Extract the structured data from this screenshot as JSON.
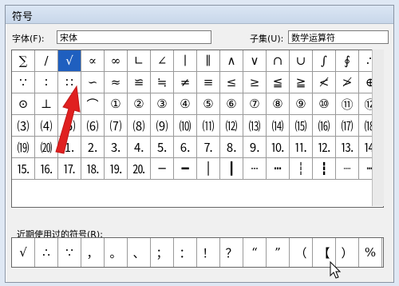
{
  "window": {
    "title": "符号"
  },
  "font": {
    "label": "字体(F):",
    "value": "宋体"
  },
  "subset": {
    "label": "子集(U):",
    "value": "数学运算符"
  },
  "grid": {
    "rows": [
      [
        "∑",
        "/",
        "√",
        "∝",
        "∞",
        "∟",
        "∠",
        "∣",
        "∥",
        "∧",
        "∨",
        "∩",
        "∪",
        "∫",
        "∮",
        "∴"
      ],
      [
        "∵",
        "∶",
        "∷",
        "∽",
        "≈",
        "≌",
        "≒",
        "≠",
        "≡",
        "≤",
        "≥",
        "≦",
        "≧",
        "≮",
        "≯",
        "⊕"
      ],
      [
        "⊙",
        "⊥",
        "⊿",
        "⌒",
        "①",
        "②",
        "③",
        "④",
        "⑤",
        "⑥",
        "⑦",
        "⑧",
        "⑨",
        "⑩",
        "⑪",
        "⑫"
      ],
      [
        "⑶",
        "⑷",
        "⑸",
        "⑹",
        "⑺",
        "⑻",
        "⑼",
        "⑽",
        "⑾",
        "⑿",
        "⒀",
        "⒁",
        "⒂",
        "⒃",
        "⒄",
        "⒅"
      ],
      [
        "⒆",
        "⒇",
        "⒈",
        "⒉",
        "⒊",
        "⒋",
        "⒌",
        "⒍",
        "⒎",
        "⒏",
        "⒐",
        "⒑",
        "⒒",
        "⒓",
        "⒔",
        "⒕"
      ],
      [
        "⒖",
        "⒗",
        "⒘",
        "⒙",
        "⒚",
        "⒛",
        "─",
        "━",
        "│",
        "┃",
        "┄",
        "┅",
        "┆",
        "┇",
        "┈",
        "┉"
      ]
    ],
    "selected": "√"
  },
  "recent": {
    "label": "近期使用过的符号(R):",
    "items": [
      "√",
      "∴",
      "∵",
      "，",
      "。",
      "、",
      "；",
      "：",
      "！",
      "？",
      "“",
      "”",
      "（",
      "【",
      "）",
      "%"
    ]
  },
  "icons": {
    "arrow": "red-arrow-icon",
    "cursor": "mouse-cursor-icon"
  },
  "colors": {
    "selected": "#1f5fbf",
    "arrow": "#e02020"
  }
}
